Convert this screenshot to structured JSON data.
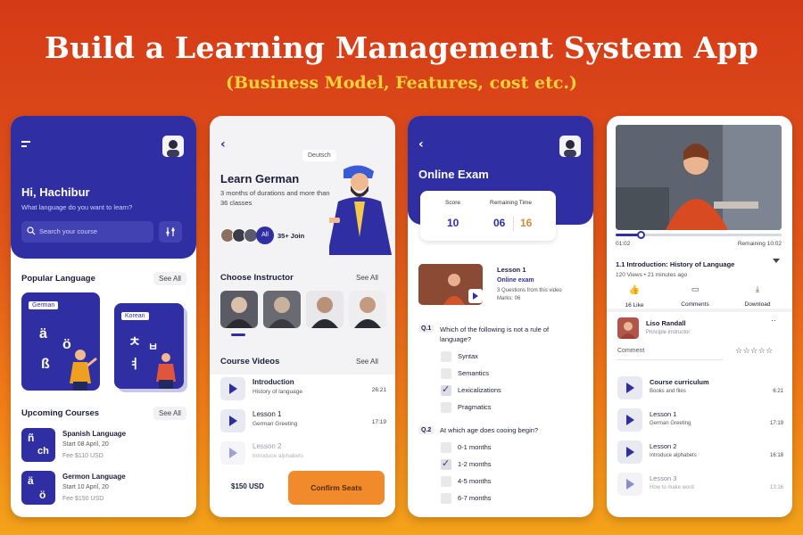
{
  "headline": "Build a Learning Management System App",
  "subhead": "(Business Model, Features, cost etc.)",
  "colors": {
    "brand": "#2f2fa3",
    "accent": "#f08a2a",
    "bg_top": "#d53a17",
    "bg_bottom": "#f4a31a"
  },
  "screen1": {
    "greeting": "Hi, Hachibur",
    "question": "What language do you want to learn?",
    "search_placeholder": "Search your course",
    "popular_title": "Popular Language",
    "see_all": "See All",
    "cards": [
      {
        "tag": "German",
        "chars": [
          "ä",
          "ö",
          "ß"
        ]
      },
      {
        "tag": "Korean",
        "chars": [
          "ㅊ",
          "ㅂ",
          "ㅕ"
        ]
      }
    ],
    "upcoming_title": "Upcoming Courses",
    "courses": [
      {
        "glyph_a": "ñ",
        "glyph_b": "ch",
        "title": "Spanish Language",
        "start": "Start 08 April, 20",
        "fee": "Fee $110 USD"
      },
      {
        "glyph_a": "ä",
        "glyph_b": "ö",
        "title": "Germon Language",
        "start": "Start 10 April, 20",
        "fee": "Fee $150 USD"
      }
    ]
  },
  "screen2": {
    "bubble": "Deutsch",
    "title": "Learn German",
    "desc": "3 months of durations and more than 36 classes",
    "all_label": "All",
    "join": "35+ Join",
    "instructor_title": "Choose Instructor",
    "see_all": "See All",
    "videos_title": "Course Videos",
    "videos": [
      {
        "title": "Introduction",
        "sub": "History of language",
        "time": "26:21"
      },
      {
        "title": "Lesson 1",
        "sub": "German Greeting",
        "time": "17:19"
      },
      {
        "title": "Lesson 2",
        "sub": "Introduce alphabets",
        "time": ""
      }
    ],
    "price": "$150 USD",
    "confirm": "Confirm Seats"
  },
  "screen3": {
    "title": "Online Exam",
    "score_label": "Score",
    "score": "10",
    "remaining_label": "Remaining Time",
    "time_min": "06",
    "time_sec": "16",
    "lesson_title": "Lesson 1",
    "lesson_sub": "Online exam",
    "lesson_info": "3 Questions from this video",
    "lesson_marks": "Marks: 06",
    "questions": [
      {
        "num": "Q.1",
        "text": "Which of the following is not a rule of language?",
        "options": [
          {
            "label": "Syntax",
            "checked": false
          },
          {
            "label": "Semantics",
            "checked": false
          },
          {
            "label": "Lexicalizations",
            "checked": true
          },
          {
            "label": "Pragmatics",
            "checked": false
          }
        ]
      },
      {
        "num": "Q.2",
        "text": "At which age does cooing begin?",
        "options": [
          {
            "label": "0-1 months",
            "checked": false
          },
          {
            "label": "1-2 months",
            "checked": true
          },
          {
            "label": "4-5 months",
            "checked": false
          },
          {
            "label": "6-7 months",
            "checked": false
          }
        ]
      }
    ]
  },
  "screen4": {
    "time_now": "01:02",
    "remaining": "Remaining 10:02",
    "progress": 0.15,
    "video_title": "1.1 Introduction: History of Language",
    "video_meta": "120 Views • 21 minutes ago",
    "like": "16 Like",
    "comments": "Comments",
    "download": "Download",
    "instructor_name": "Liso Randall",
    "instructor_role": "Principle instructor",
    "comment_placeholder": "Comment",
    "stars": "☆☆☆☆☆",
    "curriculum": [
      {
        "title": "Course curriculum",
        "sub": "Books and files",
        "time": "6:21"
      },
      {
        "title": "Lesson 1",
        "sub": "German Greeting",
        "time": "17:19"
      },
      {
        "title": "Lesson 2",
        "sub": "Introduce alphabets",
        "time": "16:18"
      },
      {
        "title": "Lesson 3",
        "sub": "How to make word",
        "time": "13:16"
      }
    ]
  }
}
